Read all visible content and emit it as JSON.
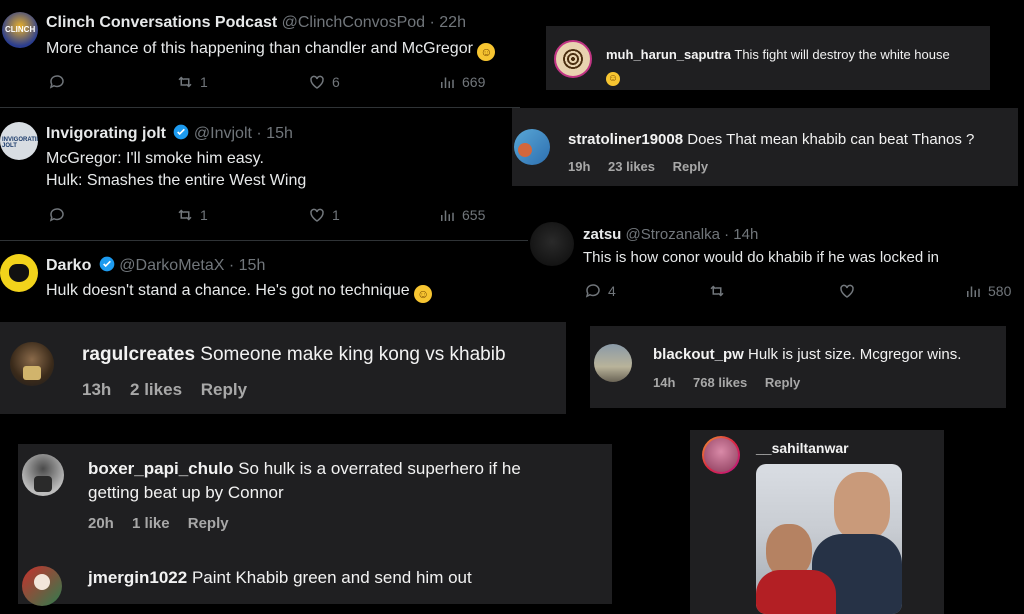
{
  "tweets": [
    {
      "name": "Clinch Conversations Podcast",
      "handle": "@ClinchConvosPod · 22h",
      "text": "More chance of this happening than chandler and McGregor",
      "retweets": "1",
      "likes": "6",
      "views": "669"
    },
    {
      "name": "Invigorating jolt",
      "handle": "@Invjolt · 15h",
      "line1": "McGregor: I'll smoke him easy.",
      "line2": "Hulk: Smashes the entire West Wing",
      "retweets": "1",
      "likes": "1",
      "views": "655"
    },
    {
      "name": "Darko",
      "handle": "@DarkoMetaX · 15h",
      "text": "Hulk doesn't stand a chance. He's got no technique"
    },
    {
      "name": "zatsu",
      "handle": "@Strozanalka · 14h",
      "text": "This is how conor would do khabib if he was locked in",
      "replies": "4",
      "views": "580"
    }
  ],
  "ig_comments": [
    {
      "user": "muh_harun_saputra",
      "text": "This fight will destroy the white house"
    },
    {
      "user": "stratoliner19008",
      "text": "Does That mean khabib can beat Thanos ?",
      "time": "19h",
      "likes": "23 likes",
      "reply": "Reply"
    },
    {
      "user": "ragulcreates",
      "text": "Someone make king kong vs khabib",
      "time": "13h",
      "likes": "2 likes",
      "reply": "Reply"
    },
    {
      "user": "blackout_pw",
      "text": "Hulk is just size. Mcgregor wins.",
      "time": "14h",
      "likes": "768 likes",
      "reply": "Reply"
    },
    {
      "user": "boxer_papi_chulo",
      "line1": "So hulk is a overrated superhero if he",
      "line2": "getting beat up by Connor",
      "time": "20h",
      "likes": "1 like",
      "reply": "Reply"
    },
    {
      "user": "jmergin1022",
      "text": "Paint Khabib green and send him out"
    }
  ],
  "story": {
    "user": "__sahiltanwar"
  },
  "colors": {
    "twitter_bg": "#000000",
    "ig_bg": "#1f1f21",
    "verified": "#1d9bf0",
    "muted": "#71767b"
  }
}
